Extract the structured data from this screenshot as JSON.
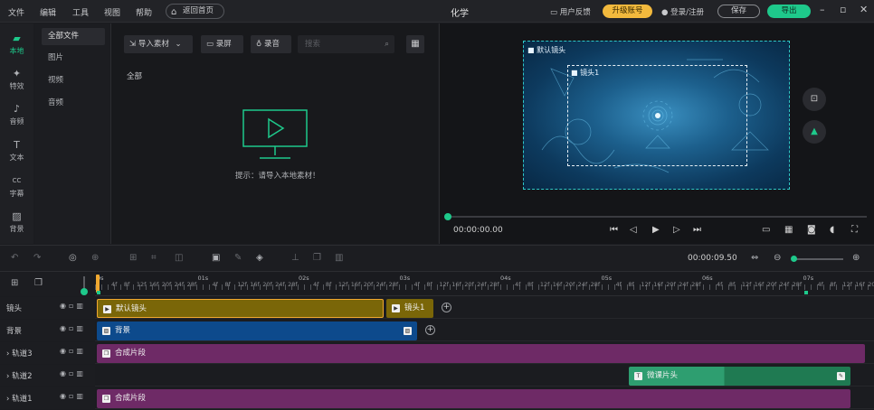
{
  "menubar": {
    "items": [
      "文件",
      "编辑",
      "工具",
      "视图",
      "帮助"
    ],
    "home_label": "返回首页",
    "title": "化学",
    "feedback": "用户反馈",
    "upgrade": "升级账号",
    "login": "登录/注册",
    "save": "保存",
    "export": "导出"
  },
  "leftnav": {
    "items": [
      {
        "label": "本地",
        "icon": "folder-icon"
      },
      {
        "label": "特效",
        "icon": "sparkle-icon"
      },
      {
        "label": "音频",
        "icon": "music-icon"
      },
      {
        "label": "文本",
        "icon": "text-icon"
      },
      {
        "label": "字幕",
        "icon": "caption-icon"
      },
      {
        "label": "背景",
        "icon": "background-icon"
      }
    ]
  },
  "subnav": {
    "items": [
      "全部文件",
      "图片",
      "视频",
      "音频"
    ]
  },
  "media": {
    "import_label": "导入素材",
    "record_screen": "录屏",
    "record_audio": "录音",
    "search_placeholder": "搜索",
    "section_label": "全部",
    "empty_hint": "提示：请导入本地素材！"
  },
  "preview": {
    "outer_label": "默认镜头",
    "inner_label": "镜头1",
    "timecode": "00:00:00.00"
  },
  "timeline": {
    "total_time": "00:00:09.50",
    "ruler_seconds": [
      "0s",
      "01s",
      "02s",
      "03s",
      "04s",
      "05s",
      "06s",
      "07s"
    ],
    "ruler_frames": [
      "4f",
      "8f",
      "12f",
      "16f",
      "20f",
      "24f",
      "28f"
    ],
    "zoom_level": 0,
    "tracks": [
      {
        "name": "镜头",
        "clips": [
          {
            "label": "默认镜头"
          },
          {
            "label": "镜头1"
          }
        ]
      },
      {
        "name": "背景",
        "clips": [
          {
            "label": "背景"
          }
        ]
      },
      {
        "name": "轨道3",
        "clips": [
          {
            "label": "合成片段"
          }
        ]
      },
      {
        "name": "轨道2",
        "clips": [
          {
            "label": "微课片头"
          }
        ]
      },
      {
        "name": "轨道1",
        "clips": [
          {
            "label": "合成片段"
          }
        ]
      }
    ]
  },
  "colors": {
    "accent": "#1ec98b",
    "upgrade": "#f2b93d",
    "camera_clip": "#7a6608",
    "background_clip": "#0d4a8c",
    "composite_clip": "#6e2a66",
    "intro_clip": "#1f8a5c"
  }
}
